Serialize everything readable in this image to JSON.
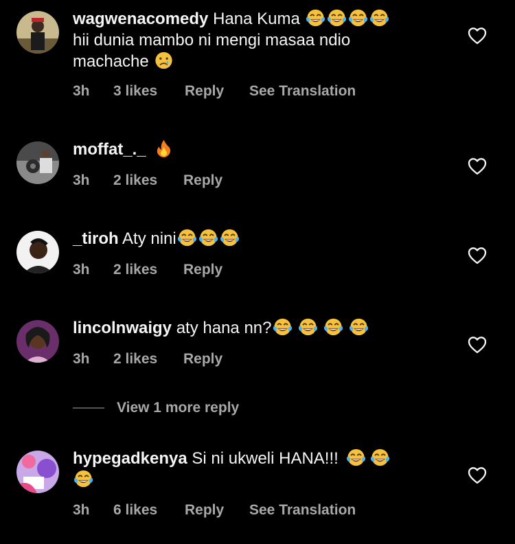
{
  "comments": [
    {
      "username": "wagwenacomedy",
      "text_line1": "Hana Kuma",
      "text_line2": "hii dunia mambo ni mengi masaa ndio",
      "text_line3": "machache",
      "time": "3h",
      "likes": "3 likes",
      "reply": "Reply",
      "translate": "See Translation"
    },
    {
      "username": "moffat_._",
      "time": "3h",
      "likes": "2 likes",
      "reply": "Reply"
    },
    {
      "username": "_tiroh",
      "text": "Aty nini",
      "time": "3h",
      "likes": "2 likes",
      "reply": "Reply"
    },
    {
      "username": "lincolnwaigy",
      "text": "aty hana nn?",
      "time": "3h",
      "likes": "2 likes",
      "reply": "Reply"
    },
    {
      "username": "hypegadkenya",
      "text": "Si ni ukweli HANA!!!",
      "time": "3h",
      "likes": "6 likes",
      "reply": "Reply",
      "translate": "See Translation"
    }
  ],
  "view_more_replies": "View 1 more reply",
  "icons": {
    "like": "heart-outline-icon",
    "laugh": "face-with-tears-of-joy-emoji",
    "cry": "crying-face-emoji",
    "fire": "fire-emoji"
  }
}
